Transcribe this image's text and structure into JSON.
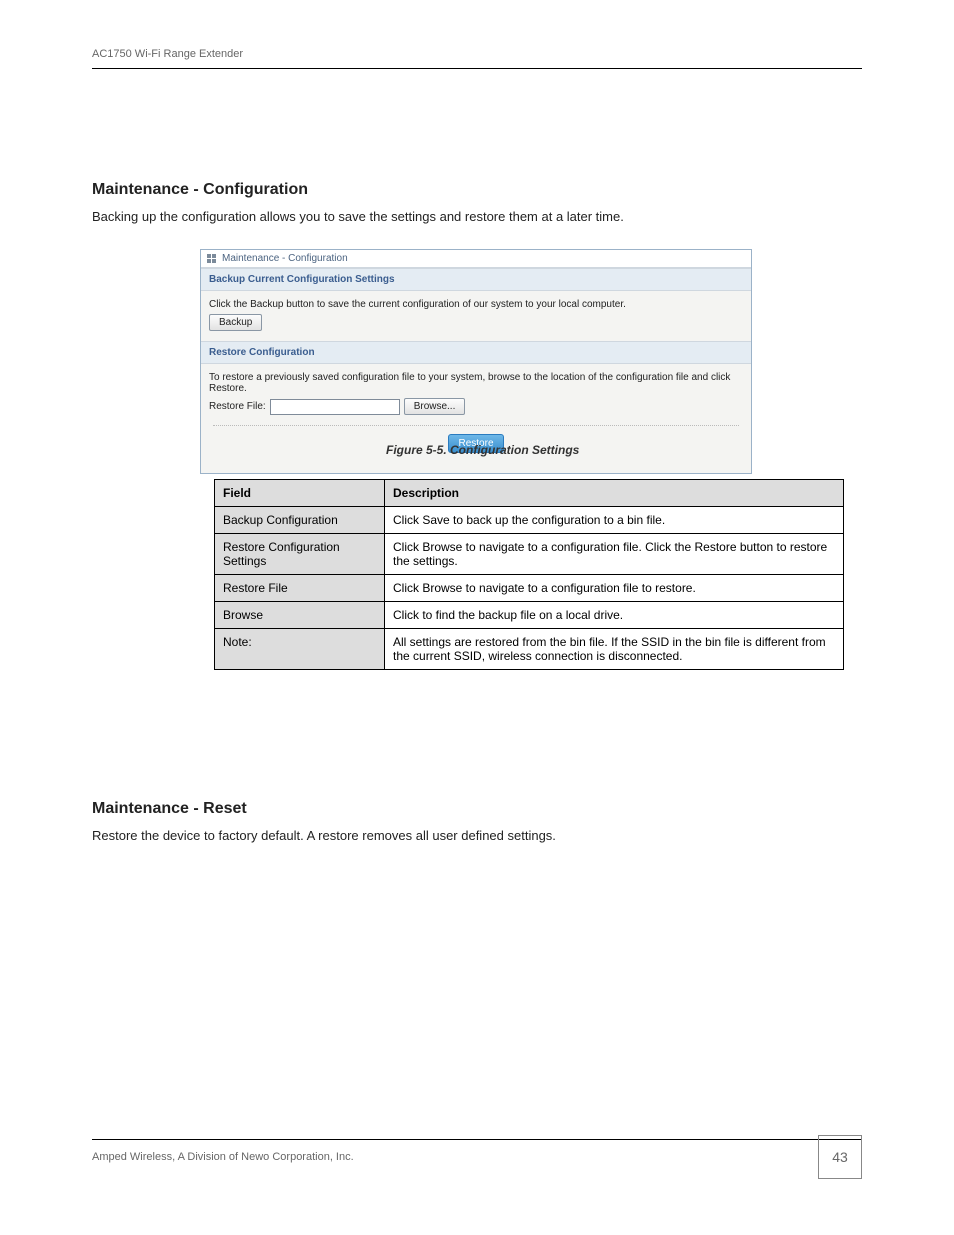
{
  "header": {
    "product": "AC1750 Wi-Fi Range Extender"
  },
  "section": {
    "intro_heading": "Maintenance - Configuration",
    "intro_body": "Backing up the configuration allows you to save the settings and restore them at a later time."
  },
  "figure": {
    "caption": "Figure 5-5. Configuration Settings",
    "breadcrumb": "Maintenance - Configuration",
    "backup_head": "Backup Current Configuration Settings",
    "backup_text": "Click the Backup button to save the current configuration of our system to your local computer.",
    "backup_btn": "Backup",
    "restore_head": "Restore Configuration",
    "restore_text": "To restore a previously saved configuration file to your system, browse to the location of the configuration file and click Restore.",
    "restore_file_label": "Restore File:",
    "browse_btn": "Browse...",
    "restore_btn": "Restore"
  },
  "table": {
    "head_field": "Field",
    "head_desc": "Description",
    "rows": [
      {
        "f": "Backup Configuration",
        "d": "Click Save to back up the configuration to a bin file."
      },
      {
        "f": "Restore Configuration Settings",
        "d": "Click Browse to navigate to a configuration file. Click the Restore button to restore the settings."
      },
      {
        "f": "Restore File",
        "d": "Click Browse to navigate to a configuration file to restore."
      },
      {
        "f": "Browse",
        "d": "Click to find the backup file on a local drive."
      },
      {
        "f": "Note:",
        "d": "All settings are restored from the bin file. If the SSID in the bin file is different from the current SSID, wireless connection is disconnected."
      }
    ]
  },
  "reset": {
    "heading": "Maintenance - Reset",
    "body": "Restore the device to factory default. A restore removes all user defined settings."
  },
  "footer": {
    "left": "Amped Wireless, A Division of Newo Corporation, Inc.",
    "page": "43"
  }
}
